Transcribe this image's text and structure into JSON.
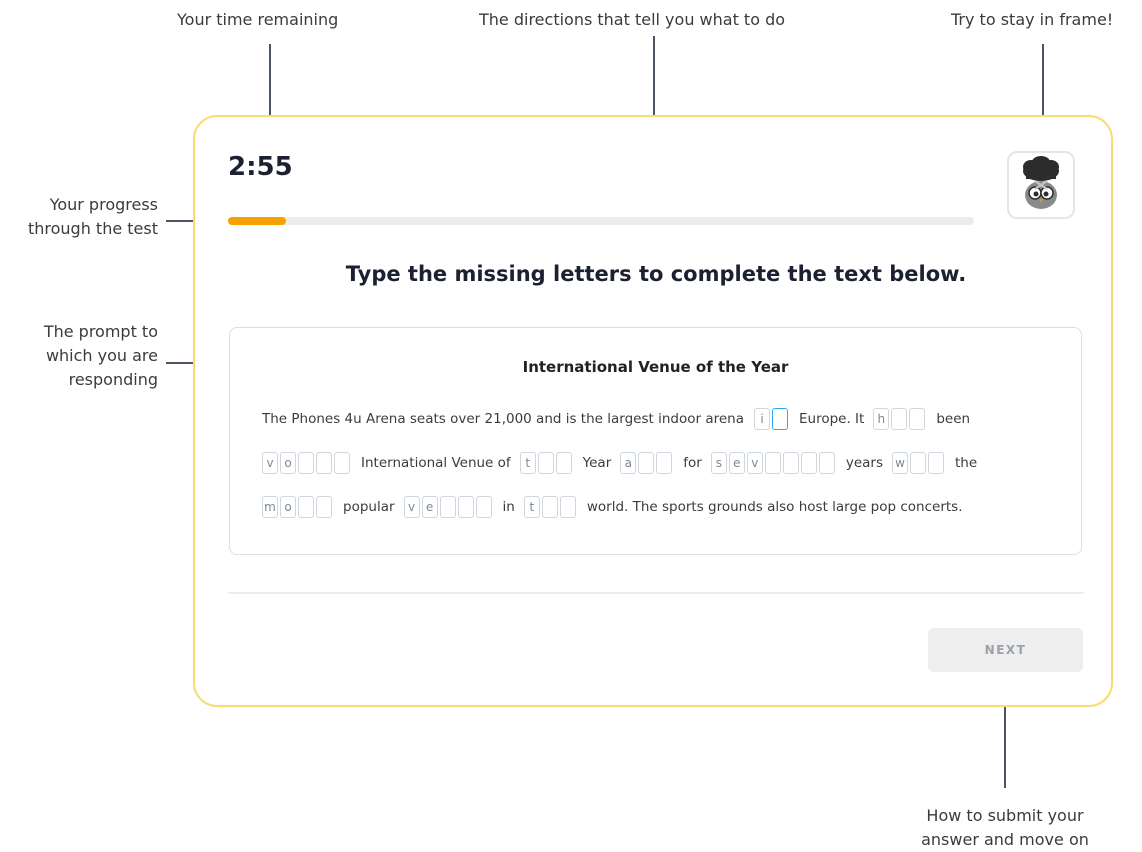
{
  "annotations": {
    "time": "Your time remaining",
    "directions": "The directions that tell you what to do",
    "frame": "Try to stay in frame!",
    "progress_line1": "Your progress",
    "progress_line2": "through the test",
    "prompt_line1": "The prompt to",
    "prompt_line2": "which you are",
    "prompt_line3": "responding",
    "submit_line1": "How to submit your",
    "submit_line2": "answer and move on"
  },
  "test": {
    "timer": "2:55",
    "progress_percent": 7.8,
    "directions": "Type the missing letters to complete the text below.",
    "prompt_title": "International Venue of the Year",
    "next_label": "NEXT"
  },
  "text_pieces": {
    "l1a": "The Phones 4u Arena seats over 21,000 and is the largest indoor arena",
    "l1b": "Europe. It",
    "l1c": "been",
    "l2a": "International Venue of",
    "l2b": "Year",
    "l2c": "for",
    "l2d": "years",
    "l2e": "the",
    "l3a": "popular",
    "l3b": "in",
    "l3c": "world. The sports grounds also host large pop concerts."
  },
  "blanks": {
    "w1": [
      "i",
      ""
    ],
    "w2": [
      "h",
      "",
      ""
    ],
    "w3": [
      "v",
      "o",
      "",
      "",
      ""
    ],
    "w4": [
      "t",
      "",
      ""
    ],
    "w5": [
      "a",
      "",
      ""
    ],
    "w6": [
      "s",
      "e",
      "v",
      "",
      "",
      "",
      ""
    ],
    "w7": [
      "w",
      "",
      ""
    ],
    "w8": [
      "m",
      "o",
      "",
      ""
    ],
    "w9": [
      "v",
      "e",
      "",
      "",
      ""
    ],
    "w10": [
      "t",
      "",
      ""
    ]
  },
  "colors": {
    "frame_border": "#f7dc6f",
    "progress_fill": "#f5a100",
    "active_cell": "#2ea8f2"
  },
  "icons": {
    "avatar": "owl-avatar-icon"
  }
}
